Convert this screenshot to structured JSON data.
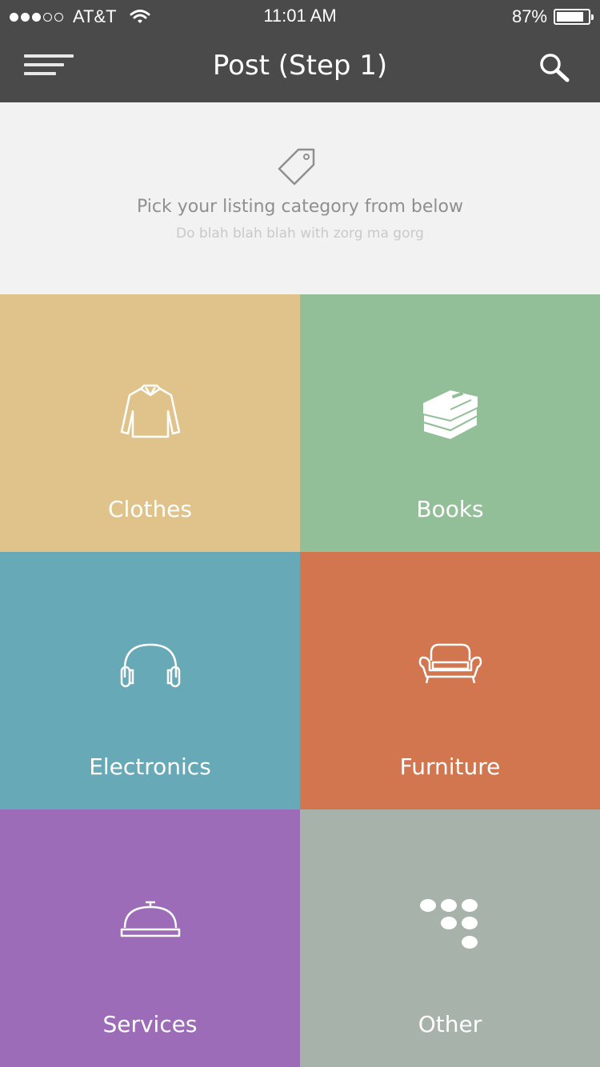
{
  "status_bar": {
    "carrier": "AT&T",
    "time": "11:01 AM",
    "battery": "87%",
    "battery_level": 0.87,
    "signal_bars_filled": 3,
    "signal_bars_total": 5
  },
  "navbar": {
    "title": "Post (Step 1)",
    "menu_icon": "hamburger-menu-icon",
    "search_icon": "search-icon",
    "background": "#4a4a4a"
  },
  "intro": {
    "icon": "tag-icon",
    "title": "Pick your listing category from below",
    "subtitle": "Do blah blah blah with zorg ma gorg"
  },
  "categories": [
    {
      "label": "Clothes",
      "icon": "shirt-icon",
      "color": "#e0c38b"
    },
    {
      "label": "Books",
      "icon": "books-icon",
      "color": "#92bf98"
    },
    {
      "label": "Electronics",
      "icon": "headphones-icon",
      "color": "#68a9b8"
    },
    {
      "label": "Furniture",
      "icon": "sofa-icon",
      "color": "#d27650"
    },
    {
      "label": "Services",
      "icon": "service-bell-icon",
      "color": "#9d6cb8"
    },
    {
      "label": "Other",
      "icon": "dots-icon",
      "color": "#a7b2aa"
    }
  ]
}
